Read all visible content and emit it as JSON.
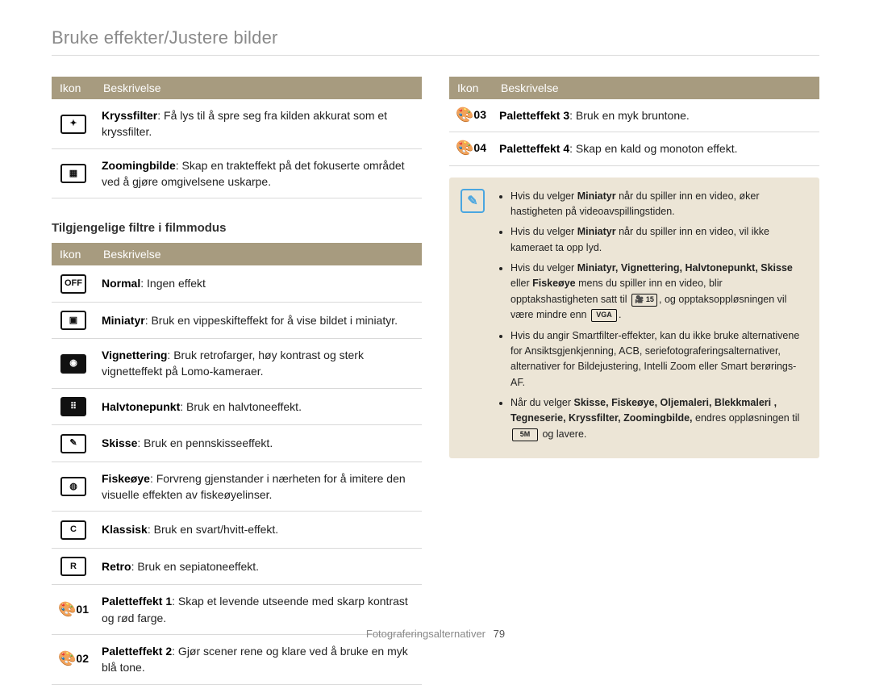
{
  "page_title": "Bruke effekter/Justere bilder",
  "headers": {
    "ikon": "Ikon",
    "beskrivelse": "Beskrivelse"
  },
  "section2_title": "Tilgjengelige filtre i filmmodus",
  "table1": [
    {
      "icon_name": "crossfilter-icon",
      "icon_text": "✦",
      "bold": "Kryssfilter",
      "rest": ": Få lys til å spre seg fra kilden akkurat som et kryssfilter."
    },
    {
      "icon_name": "zoom-blur-icon",
      "icon_text": "▦",
      "bold": "Zoomingbilde",
      "rest": ": Skap en trakteffekt på det fokuserte området ved å gjøre omgivelsene uskarpe."
    }
  ],
  "table2": [
    {
      "icon_name": "normal-icon",
      "icon_variant": "light",
      "icon_text": "OFF",
      "bold": "Normal",
      "rest": ": Ingen effekt"
    },
    {
      "icon_name": "miniature-icon",
      "icon_variant": "light",
      "icon_text": "▣",
      "bold": "Miniatyr",
      "rest": ": Bruk en vippeskifteffekt for å vise bildet i miniatyr."
    },
    {
      "icon_name": "vignetting-icon",
      "icon_variant": "dark",
      "icon_text": "◉",
      "bold": "Vignettering",
      "rest": ": Bruk retrofarger, høy kontrast og sterk vignetteffekt på Lomo-kameraer."
    },
    {
      "icon_name": "halftone-icon",
      "icon_variant": "dark",
      "icon_text": "⠿",
      "bold": "Halvtonepunkt",
      "rest": ": Bruk en halvtoneeffekt."
    },
    {
      "icon_name": "sketch-icon",
      "icon_variant": "light",
      "icon_text": "✎",
      "bold": "Skisse",
      "rest": ": Bruk en pennskisseeffekt."
    },
    {
      "icon_name": "fisheye-icon",
      "icon_variant": "light",
      "icon_text": "◍",
      "bold": "Fiskeøye",
      "rest": ": Forvreng gjenstander i nærheten for å imitere den visuelle effekten av fiskeøyelinser."
    },
    {
      "icon_name": "classic-icon",
      "icon_variant": "light",
      "icon_text": "C",
      "bold": "Klassisk",
      "rest": ": Bruk en svart/hvitt-effekt."
    },
    {
      "icon_name": "retro-icon",
      "icon_variant": "light",
      "icon_text": "R",
      "bold": "Retro",
      "rest": ": Bruk en sepiatoneeffekt."
    },
    {
      "icon_name": "palette1-icon",
      "icon_variant": "pal",
      "icon_text": "01",
      "bold": "Paletteffekt 1",
      "rest": ": Skap et levende utseende med skarp kontrast og rød farge."
    },
    {
      "icon_name": "palette2-icon",
      "icon_variant": "pal",
      "icon_text": "02",
      "bold": "Paletteffekt 2",
      "rest": ": Gjør scener rene og klare ved å bruke en myk blå tone."
    }
  ],
  "table3": [
    {
      "icon_name": "palette3-icon",
      "icon_variant": "pal",
      "icon_text": "03",
      "bold": "Paletteffekt 3",
      "rest": ": Bruk en myk bruntone."
    },
    {
      "icon_name": "palette4-icon",
      "icon_variant": "pal",
      "icon_text": "04",
      "bold": "Paletteffekt 4",
      "rest": ": Skap en kald og monoton effekt."
    }
  ],
  "info_items": [
    {
      "pre": "Hvis du velger ",
      "b1": "Miniatyr",
      "post": " når du spiller inn en video, øker hastigheten på videoavspillingstiden."
    },
    {
      "pre": "Hvis du velger ",
      "b1": "Miniatyr",
      "post": " når du spiller inn en video, vil ikke kameraet ta opp lyd."
    },
    {
      "pre": "Hvis du velger ",
      "b_list": "Miniatyr, Vignettering, Halvtonepunkt, Skisse",
      "mid": " eller ",
      "b2": "Fiskeøye",
      "post1": " mens du spiller inn en video, blir opptakshastigheten satt til ",
      "icon1": "🎥 15",
      "post2": ", og opptaksoppløsningen vil være mindre enn ",
      "icon2": "VGA",
      "post3": "."
    },
    {
      "pre": "Hvis du angir Smartfilter-effekter, kan du ikke bruke alternativene for Ansiktsgjenkjenning, ACB, seriefotograferingsalternativer, alternativer for Bildejustering, Intelli Zoom eller Smart berørings-AF."
    },
    {
      "pre": "Når du velger ",
      "b_list": "Skisse, Fiskeøye, Oljemaleri, Blekkmaleri , Tegneserie, Kryssfilter, Zoomingbilde,",
      "post1": " endres oppløsningen til ",
      "icon1": "5M",
      "post2": " og lavere."
    }
  ],
  "footer": {
    "label": "Fotograferingsalternativer",
    "page": "79"
  }
}
